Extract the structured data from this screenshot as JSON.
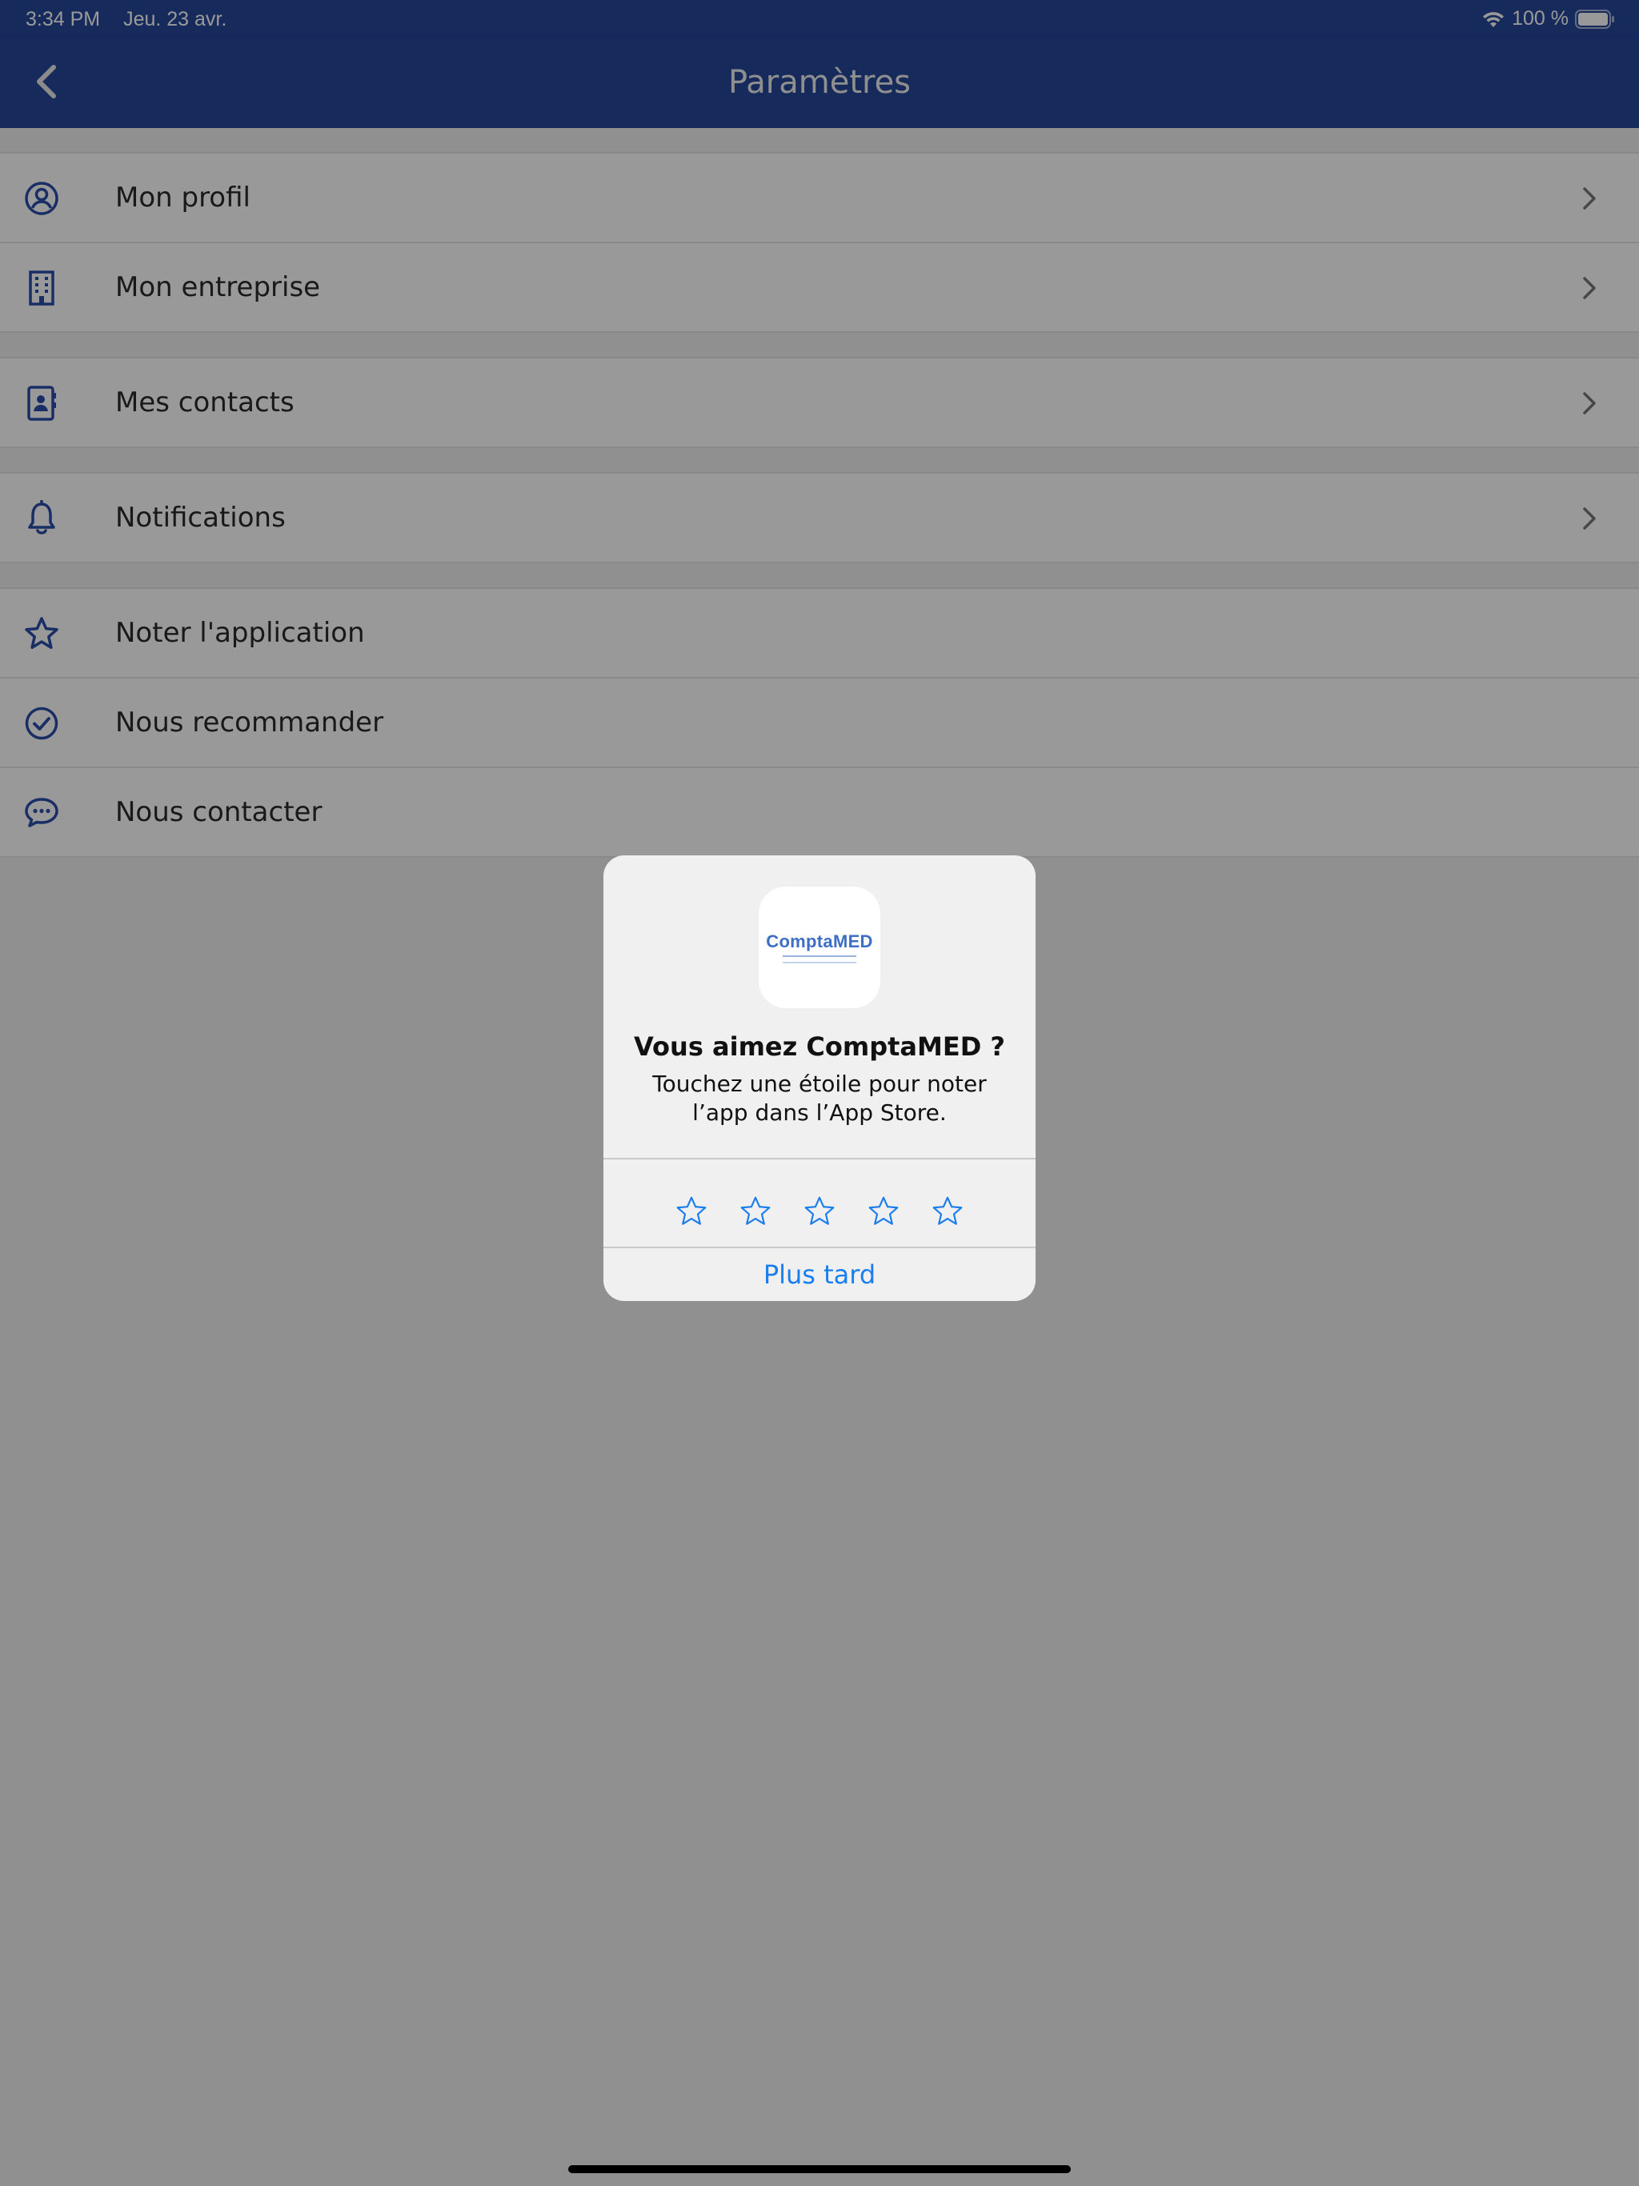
{
  "status_bar": {
    "time": "3:34 PM",
    "date": "Jeu. 23 avr.",
    "battery": "100 %",
    "wifi_icon": "wifi-icon",
    "battery_icon": "battery-icon"
  },
  "nav": {
    "title": "Paramètres",
    "back_icon": "chevron-left-icon"
  },
  "settings": {
    "group1": [
      {
        "label": "Mon profil",
        "icon": "user-circle-icon"
      },
      {
        "label": "Mon entreprise",
        "icon": "building-icon"
      }
    ],
    "group2": [
      {
        "label": "Mes contacts",
        "icon": "contacts-book-icon"
      }
    ],
    "group3": [
      {
        "label": "Notifications",
        "icon": "bell-icon"
      }
    ],
    "group4": [
      {
        "label": "Noter l'application",
        "icon": "star-icon"
      },
      {
        "label": "Nous recommander",
        "icon": "check-circle-icon"
      },
      {
        "label": "Nous contacter",
        "icon": "chat-bubble-icon"
      }
    ]
  },
  "rating_dialog": {
    "app_name_logo": "ComptaMED",
    "title": "Vous aimez ComptaMED ?",
    "message": "Touchez une étoile pour noter l’app dans l’App Store.",
    "star_count": 5,
    "later_label": "Plus tard"
  },
  "colors": {
    "brand_blue": "#25469a",
    "icon_blue": "#2b4ea8",
    "link_blue": "#1a7ef0"
  }
}
